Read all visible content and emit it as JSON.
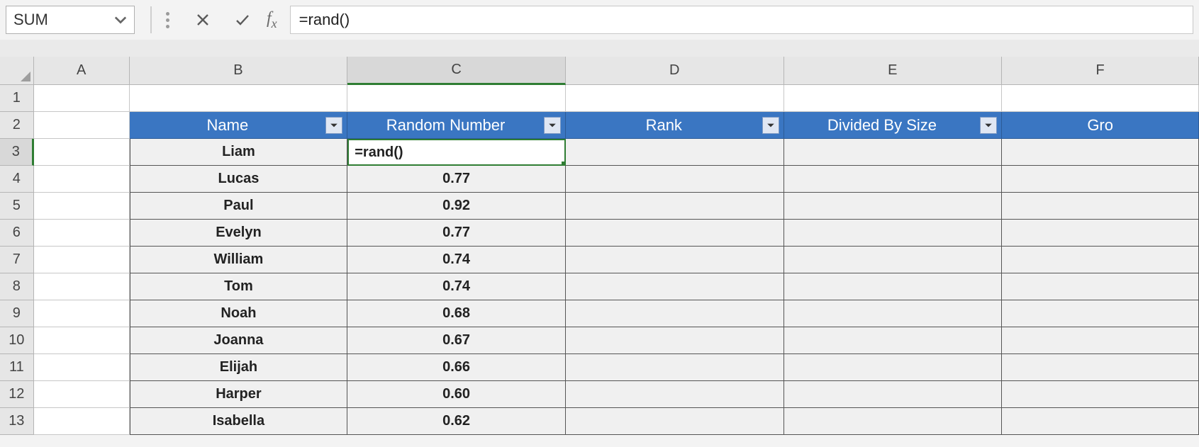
{
  "formula_bar": {
    "name_box": "SUM",
    "formula": "=rand()"
  },
  "columns": [
    "A",
    "B",
    "C",
    "D",
    "E",
    "F"
  ],
  "active_column": "C",
  "active_row": "3",
  "row_numbers": [
    "1",
    "2",
    "3",
    "4",
    "5",
    "6",
    "7",
    "8",
    "9",
    "10",
    "11",
    "12",
    "13"
  ],
  "table_headers": {
    "B": "Name",
    "C": "Random Number",
    "D": "Rank",
    "E": "Divided By Size",
    "F": "Gro"
  },
  "editing_cell_value": "=rand()",
  "rows": [
    {
      "name": "Liam",
      "rand": ""
    },
    {
      "name": "Lucas",
      "rand": "0.77"
    },
    {
      "name": "Paul",
      "rand": "0.92"
    },
    {
      "name": "Evelyn",
      "rand": "0.77"
    },
    {
      "name": "William",
      "rand": "0.74"
    },
    {
      "name": "Tom",
      "rand": "0.74"
    },
    {
      "name": "Noah",
      "rand": "0.68"
    },
    {
      "name": "Joanna",
      "rand": "0.67"
    },
    {
      "name": "Elijah",
      "rand": "0.66"
    },
    {
      "name": "Harper",
      "rand": "0.60"
    },
    {
      "name": "Isabella",
      "rand": "0.62"
    }
  ]
}
